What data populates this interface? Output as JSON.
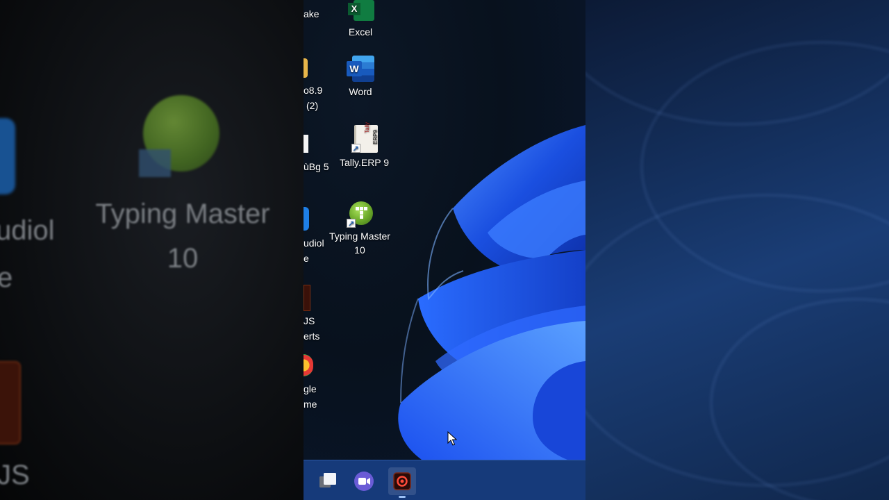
{
  "left_panel_blurred": {
    "typing_master_line1": "Typing Master",
    "typing_master_line2": "10",
    "audio_fragment": "udiol",
    "e_fragment": "e",
    "us_fragment": "JS"
  },
  "desktop": {
    "icons": [
      {
        "id": "excel",
        "label": "Excel",
        "icon": "excel-icon"
      },
      {
        "id": "word",
        "label": "Word",
        "icon": "word-icon"
      },
      {
        "id": "tally",
        "label": "Tally.ERP 9",
        "icon": "tally-erp9-icon"
      },
      {
        "id": "typing_master",
        "label_line1": "Typing Master",
        "label_line2": "10",
        "icon": "typing-master-icon"
      }
    ],
    "partial_labels": {
      "p1": "ake",
      "p2a": "o8.9",
      "p2b": "(2)",
      "p3": "ùBg 5",
      "p4a": "udiol",
      "p4b": "e",
      "p5a": "JS",
      "p5b": "erts",
      "p6a": "gle",
      "p6b": "me"
    }
  },
  "taskbar": {
    "buttons": [
      {
        "id": "task-view",
        "icon": "task-view-icon"
      },
      {
        "id": "meet",
        "icon": "meet-now-icon"
      },
      {
        "id": "screen-recorder",
        "icon": "screen-recorder-icon",
        "active": true
      }
    ]
  },
  "colors": {
    "taskbar": "#163a7a",
    "bloom": "#1e5cff",
    "desktop_bg": "#08111d"
  }
}
